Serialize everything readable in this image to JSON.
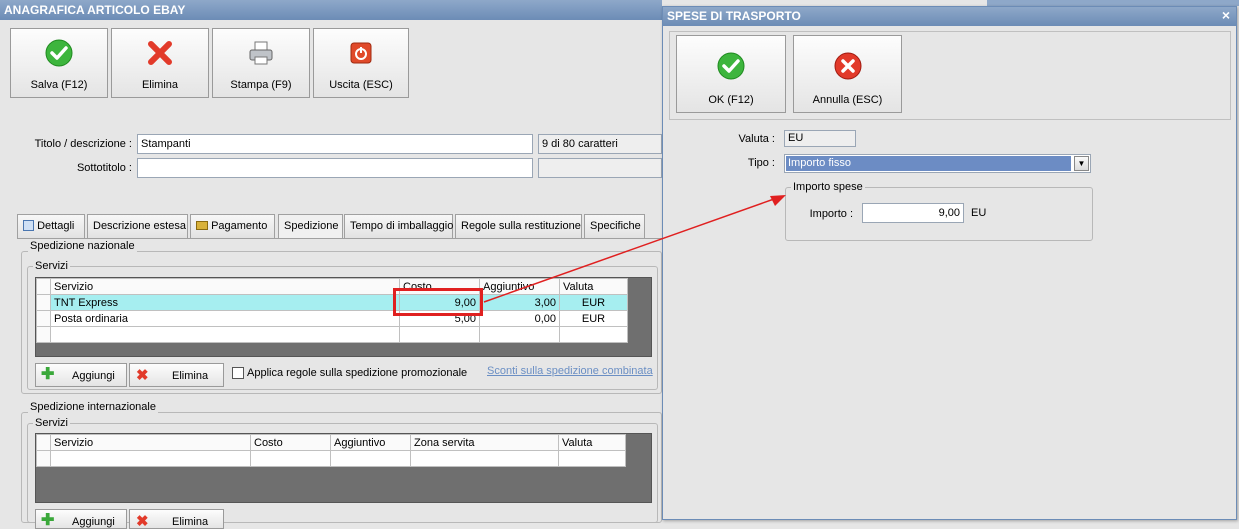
{
  "main": {
    "title": "ANAGRAFICA ARTICOLO EBAY",
    "toolbar": {
      "save": "Salva (F12)",
      "delete": "Elimina",
      "print": "Stampa (F9)",
      "exit": "Uscita (ESC)"
    },
    "form": {
      "title_label": "Titolo / descrizione :",
      "title_value": "Stampanti",
      "title_counter": "9 di 80 caratteri",
      "subtitle_label": "Sottotitolo :",
      "subtitle_value": ""
    },
    "tabs": [
      "Dettagli",
      "Descrizione estesa",
      "Pagamento",
      "Spedizione",
      "Tempo di imballaggio",
      "Regole sulla restituzione",
      "Specifiche"
    ],
    "national": {
      "title": "Spedizione nazionale",
      "services_title": "Servizi",
      "headers": [
        "Servizio",
        "Costo",
        "Aggiuntivo",
        "Valuta"
      ],
      "rows": [
        [
          "TNT Express",
          "9,00",
          "3,00",
          "EUR"
        ],
        [
          "Posta ordinaria",
          "5,00",
          "0,00",
          "EUR"
        ]
      ],
      "add": "Aggiungi",
      "delete": "Elimina",
      "promo_checkbox": "Applica regole sulla spedizione promozionale",
      "combined_link": "Sconti sulla spedizione combinata"
    },
    "international": {
      "title": "Spedizione internazionale",
      "services_title": "Servizi",
      "headers": [
        "Servizio",
        "Costo",
        "Aggiuntivo",
        "Zona servita",
        "Valuta"
      ],
      "add": "Aggiungi",
      "delete": "Elimina"
    }
  },
  "dialog": {
    "title": "SPESE DI TRASPORTO",
    "close": "×",
    "ok": "OK (F12)",
    "cancel": "Annulla (ESC)",
    "valuta_label": "Valuta :",
    "valuta_value": "EU",
    "tipo_label": "Tipo :",
    "tipo_value": "Importo fisso",
    "group_title": "Importo spese",
    "importo_label": "Importo :",
    "importo_value": "9,00",
    "importo_unit": "EU"
  },
  "colors": {
    "selected_row": "#a6eef0",
    "highlight_box": "#e02020",
    "annotation_arrow": "#e02020",
    "titlebar": "#7a98c0"
  }
}
